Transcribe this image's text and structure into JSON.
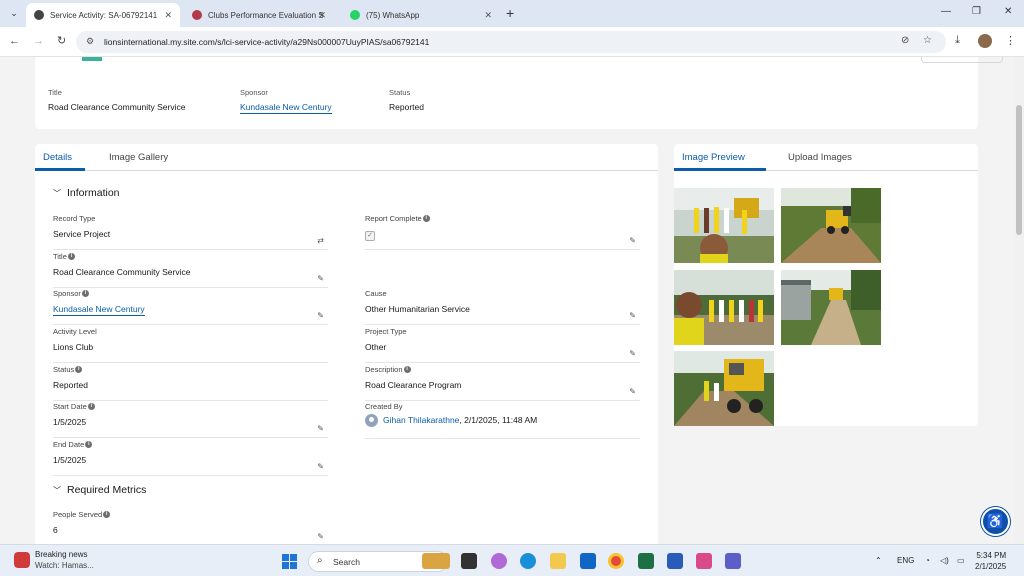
{
  "browser": {
    "tabs": [
      {
        "title": "Service Activity: SA-06792141",
        "active": true
      },
      {
        "title": "Clubs Performance Evaluation S",
        "active": false
      },
      {
        "title": "(75) WhatsApp",
        "active": false
      }
    ],
    "url": "lionsinternational.my.site.com/s/lci-service-activity/a29Ns000007UuyPIAS/sa06792141"
  },
  "header": {
    "partial_title": "SA-06792141",
    "fields": [
      {
        "label": "Title",
        "value": "Road Clearance Community Service"
      },
      {
        "label": "Sponsor",
        "value": "Kundasale New Century"
      },
      {
        "label": "Status",
        "value": "Reported"
      }
    ]
  },
  "left_tabs": [
    "Details",
    "Image Gallery"
  ],
  "sections": {
    "information": "Information",
    "required_metrics": "Required Metrics"
  },
  "fields": {
    "record_type": {
      "label": "Record Type",
      "value": "Service Project"
    },
    "report_complete": {
      "label": "Report Complete",
      "checked": true
    },
    "title": {
      "label": "Title",
      "value": "Road Clearance Community Service"
    },
    "sponsor": {
      "label": "Sponsor",
      "value": "Kundasale New Century"
    },
    "cause": {
      "label": "Cause",
      "value": "Other Humanitarian Service"
    },
    "activity_level": {
      "label": "Activity Level",
      "value": "Lions Club"
    },
    "project_type": {
      "label": "Project Type",
      "value": "Other"
    },
    "status": {
      "label": "Status",
      "value": "Reported"
    },
    "description": {
      "label": "Description",
      "value": "Road Clearance Program"
    },
    "start_date": {
      "label": "Start Date",
      "value": "1/5/2025"
    },
    "created_by": {
      "label": "Created By",
      "name": "Gihan Thilakarathne",
      "date": ", 2/1/2025, 11:48 AM"
    },
    "end_date": {
      "label": "End Date",
      "value": "1/5/2025"
    },
    "people_served": {
      "label": "People Served",
      "value": "6"
    }
  },
  "right_tabs": [
    "Image Preview",
    "Upload Images"
  ],
  "images": [
    "photo-people-and-excavator",
    "photo-excavator-on-road",
    "photo-selfie-with-group",
    "photo-excavator-near-building",
    "photo-excavator-with-people"
  ],
  "taskbar": {
    "news_title": "Breaking news",
    "news_sub": "Watch: Hamas...",
    "search_placeholder": "Search",
    "lang": "ENG",
    "time": "5:34 PM",
    "date": "2/1/2025"
  },
  "colors": {
    "accent": "#0b5cab",
    "page_bg": "#f3f3f3",
    "tab_bar": "#dfe6f3"
  }
}
